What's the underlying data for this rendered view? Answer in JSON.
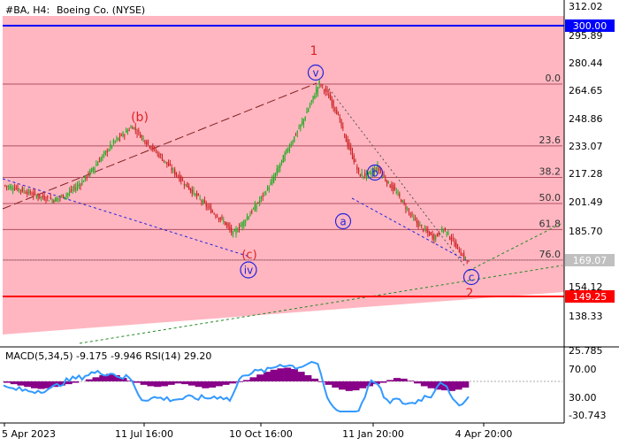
{
  "header": {
    "symbol": "#BA, H4:",
    "name": "Boeing Co. (NYSE)"
  },
  "colors": {
    "zone": "#ffb6c1",
    "axis": "#000000",
    "resistance": "#0000ff",
    "support": "#ff0000",
    "price_label": "#c0c0c0",
    "wave_red": "#dd2222",
    "wave_blue": "#2222dd",
    "bull_candle": "#22aa22",
    "bear_candle": "#cc2222",
    "macd_hist": "#880088",
    "rsi_line": "#3399ff"
  },
  "main_axis": {
    "ticks": [
      "312.02",
      "295.89",
      "280.44",
      "264.65",
      "248.86",
      "233.07",
      "217.28",
      "201.49",
      "185.70",
      "169.07",
      "154.12",
      "138.33"
    ]
  },
  "price_labels": {
    "resistance": "300.00",
    "current": "169.07",
    "support": "149.25"
  },
  "fib_levels": [
    {
      "label": "0.0",
      "price": 267.5
    },
    {
      "label": "23.6",
      "price": 233.07
    },
    {
      "label": "38.2",
      "price": 215.5
    },
    {
      "label": "50.0",
      "price": 201.0
    },
    {
      "label": "61.8",
      "price": 186.5
    },
    {
      "label": "76.0",
      "price": 169.5
    }
  ],
  "wave_labels": [
    {
      "text": "(b)",
      "style": "red-plain"
    },
    {
      "text": "1",
      "style": "red-plain"
    },
    {
      "text": "v",
      "style": "blue-circle"
    },
    {
      "text": "b",
      "style": "blue-circle"
    },
    {
      "text": "a",
      "style": "blue-circle"
    },
    {
      "text": "(c)",
      "style": "red-plain"
    },
    {
      "text": "iv",
      "style": "blue-circle"
    },
    {
      "text": "c",
      "style": "blue-circle"
    },
    {
      "text": "2",
      "style": "red-plain"
    }
  ],
  "indicator": {
    "label": "MACD(5,34,5) -9.175 -9.946 RSI(14) 29.20",
    "ticks": [
      "25.785",
      "70.00",
      "30.00",
      "-30.743"
    ]
  },
  "time_axis": {
    "labels": [
      "5 Apr 2023",
      "11 Jul 16:00",
      "10 Oct 16:00",
      "11 Jan 20:00",
      "4 Apr 20:00"
    ]
  },
  "chart_data": {
    "type": "candlestick",
    "y_range": [
      130,
      318
    ],
    "resistance": 300.0,
    "support": 149.25,
    "current": 169.07,
    "waypoints": [
      [
        0,
        211
      ],
      [
        10,
        209
      ],
      [
        22,
        205
      ],
      [
        32,
        203
      ],
      [
        40,
        206
      ],
      [
        50,
        213
      ],
      [
        60,
        224
      ],
      [
        70,
        235
      ],
      [
        82,
        244
      ],
      [
        90,
        236
      ],
      [
        100,
        227
      ],
      [
        112,
        215
      ],
      [
        122,
        206
      ],
      [
        132,
        197
      ],
      [
        140,
        191
      ],
      [
        146,
        184
      ],
      [
        152,
        190
      ],
      [
        160,
        199
      ],
      [
        170,
        212
      ],
      [
        180,
        230
      ],
      [
        190,
        246
      ],
      [
        196,
        258
      ],
      [
        201,
        268
      ],
      [
        206,
        262
      ],
      [
        212,
        252
      ],
      [
        218,
        236
      ],
      [
        224,
        223
      ],
      [
        226,
        217
      ],
      [
        232,
        217
      ],
      [
        238,
        221
      ],
      [
        244,
        213
      ],
      [
        250,
        207
      ],
      [
        256,
        199
      ],
      [
        262,
        191
      ],
      [
        268,
        186
      ],
      [
        274,
        182
      ],
      [
        280,
        187
      ],
      [
        286,
        180
      ],
      [
        292,
        172
      ],
      [
        296,
        168
      ]
    ],
    "macd_hist": [
      -2,
      -4,
      -6,
      -8,
      -10,
      -11,
      -10,
      -8,
      -6,
      -4,
      -2,
      0,
      3,
      6,
      9,
      11,
      9,
      5,
      1,
      -2,
      -5,
      -7,
      -8,
      -7,
      -5,
      -3,
      -4,
      -6,
      -8,
      -10,
      -9,
      -7,
      -5,
      -3,
      -1,
      2,
      6,
      10,
      14,
      17,
      19,
      20,
      18,
      14,
      9,
      4,
      -1,
      -5,
      -9,
      -12,
      -14,
      -13,
      -10,
      -7,
      -4,
      -2,
      2,
      5,
      4,
      1,
      -3,
      -7,
      -10,
      -12,
      -13,
      -14,
      -12,
      -9
    ]
  }
}
